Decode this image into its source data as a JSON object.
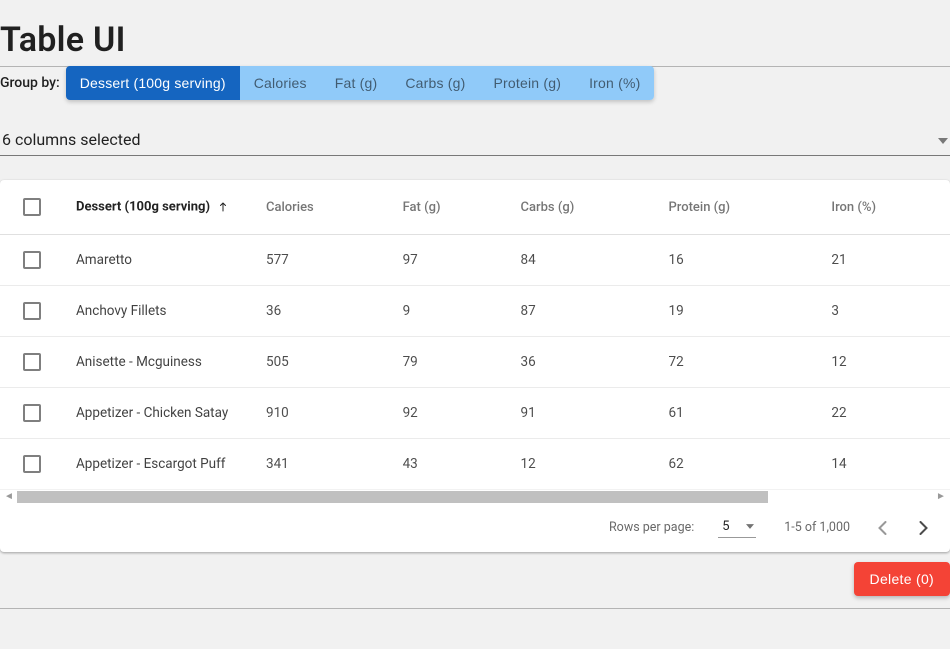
{
  "title": "Table UI",
  "group_by": {
    "label": "Group by:",
    "items": [
      {
        "label": "Dessert (100g serving)",
        "active": true
      },
      {
        "label": "Calories",
        "active": false
      },
      {
        "label": "Fat (g)",
        "active": false
      },
      {
        "label": "Carbs (g)",
        "active": false
      },
      {
        "label": "Protein (g)",
        "active": false
      },
      {
        "label": "Iron (%)",
        "active": false
      }
    ]
  },
  "column_selector": {
    "text": "6 columns selected"
  },
  "table": {
    "columns": [
      {
        "label": "Dessert (100g serving)",
        "sorted": "asc"
      },
      {
        "label": "Calories"
      },
      {
        "label": "Fat (g)"
      },
      {
        "label": "Carbs (g)"
      },
      {
        "label": "Protein (g)"
      },
      {
        "label": "Iron (%)"
      }
    ],
    "rows": [
      {
        "name": "Amaretto",
        "calories": "577",
        "fat": "97",
        "carbs": "84",
        "protein": "16",
        "iron": "21"
      },
      {
        "name": "Anchovy Fillets",
        "calories": "36",
        "fat": "9",
        "carbs": "87",
        "protein": "19",
        "iron": "3"
      },
      {
        "name": "Anisette - Mcguiness",
        "calories": "505",
        "fat": "79",
        "carbs": "36",
        "protein": "72",
        "iron": "12"
      },
      {
        "name": "Appetizer - Chicken Satay",
        "calories": "910",
        "fat": "92",
        "carbs": "91",
        "protein": "61",
        "iron": "22"
      },
      {
        "name": "Appetizer - Escargot Puff",
        "calories": "341",
        "fat": "43",
        "carbs": "12",
        "protein": "62",
        "iron": "14"
      }
    ]
  },
  "pagination": {
    "rows_per_page_label": "Rows per page:",
    "rows_per_page_value": "5",
    "range_text": "1-5 of 1,000"
  },
  "actions": {
    "delete_label": "Delete (0)"
  }
}
